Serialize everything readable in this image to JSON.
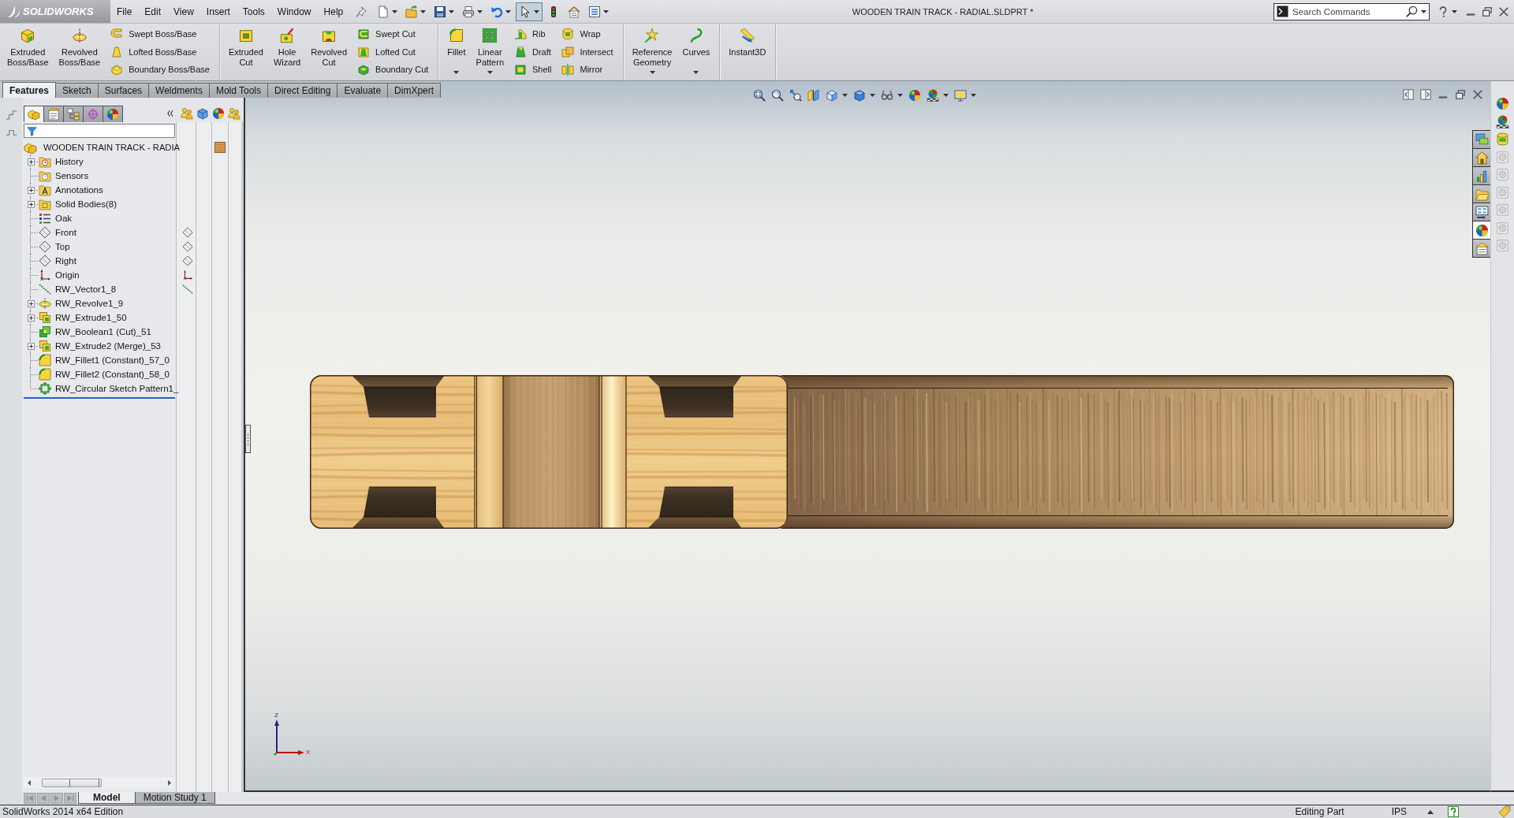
{
  "app": {
    "logo": "SOLIDWORKS"
  },
  "menu": [
    "File",
    "Edit",
    "View",
    "Insert",
    "Tools",
    "Window",
    "Help"
  ],
  "quick_access": [
    {
      "kind": "new",
      "dropdown": true,
      "pressed": false
    },
    {
      "kind": "open",
      "dropdown": true,
      "pressed": false
    },
    {
      "kind": "save",
      "dropdown": true,
      "pressed": false
    },
    {
      "kind": "print",
      "dropdown": true,
      "pressed": false
    },
    {
      "kind": "undo",
      "dropdown": true,
      "pressed": false
    },
    {
      "kind": "select",
      "dropdown": true,
      "pressed": true
    },
    {
      "kind": "rebuild",
      "dropdown": false,
      "pressed": false
    },
    {
      "kind": "file-properties",
      "dropdown": false,
      "pressed": false
    },
    {
      "kind": "options",
      "dropdown": true,
      "pressed": false
    }
  ],
  "window": {
    "title": "WOODEN TRAIN TRACK - RADIAL.SLDPRT *"
  },
  "search": {
    "placeholder": "Search Commands"
  },
  "command_manager": {
    "groups": [
      {
        "items": [
          {
            "label": "Extruded Boss/Base",
            "kind": "large",
            "dropdown": false
          },
          {
            "label": "Revolved Boss/Base",
            "kind": "large",
            "dropdown": false
          },
          {
            "label": "Swept Boss/Base",
            "kind": "small",
            "dropdown": false
          },
          {
            "label": "Lofted Boss/Base",
            "kind": "small",
            "dropdown": false
          },
          {
            "label": "Boundary Boss/Base",
            "kind": "small",
            "dropdown": false
          }
        ]
      },
      {
        "items": [
          {
            "label": "Extruded Cut",
            "kind": "large",
            "dropdown": false
          },
          {
            "label": "Hole Wizard",
            "kind": "large",
            "dropdown": false
          },
          {
            "label": "Revolved Cut",
            "kind": "large",
            "dropdown": false
          },
          {
            "label": "Swept Cut",
            "kind": "small",
            "dropdown": false
          },
          {
            "label": "Lofted Cut",
            "kind": "small",
            "dropdown": false
          },
          {
            "label": "Boundary Cut",
            "kind": "small",
            "dropdown": false
          }
        ]
      },
      {
        "items": [
          {
            "label": "Fillet",
            "kind": "large",
            "dropdown": true
          },
          {
            "label": "Linear Pattern",
            "kind": "large",
            "dropdown": true
          },
          {
            "label": "Rib",
            "kind": "small",
            "dropdown": false
          },
          {
            "label": "Draft",
            "kind": "small",
            "dropdown": false
          },
          {
            "label": "Shell",
            "kind": "small",
            "dropdown": false
          },
          {
            "label": "Wrap",
            "kind": "small",
            "dropdown": false
          },
          {
            "label": "Intersect",
            "kind": "small",
            "dropdown": false
          },
          {
            "label": "Mirror",
            "kind": "small",
            "dropdown": false
          }
        ]
      },
      {
        "items": [
          {
            "label": "Reference Geometry",
            "kind": "large",
            "dropdown": true
          },
          {
            "label": "Curves",
            "kind": "large",
            "dropdown": true
          }
        ]
      },
      {
        "items": [
          {
            "label": "Instant3D",
            "kind": "large",
            "dropdown": false
          }
        ]
      }
    ]
  },
  "tabs": [
    {
      "label": "Features",
      "selected": true
    },
    {
      "label": "Sketch",
      "selected": false
    },
    {
      "label": "Surfaces",
      "selected": false
    },
    {
      "label": "Weldments",
      "selected": false
    },
    {
      "label": "Mold Tools",
      "selected": false
    },
    {
      "label": "Direct Editing",
      "selected": false
    },
    {
      "label": "Evaluate",
      "selected": false
    },
    {
      "label": "DimXpert",
      "selected": false
    }
  ],
  "feature_manager": {
    "panel_tabs": [
      {
        "selected": true
      },
      {
        "selected": false
      },
      {
        "selected": false
      },
      {
        "selected": false
      },
      {
        "selected": false
      }
    ],
    "root": {
      "label": "WOODEN TRAIN TRACK - RADIA",
      "display": true
    },
    "items": [
      {
        "label": "History",
        "kind": "history",
        "expandable": true,
        "display": false
      },
      {
        "label": "Sensors",
        "kind": "sensors",
        "expandable": false,
        "display": false
      },
      {
        "label": "Annotations",
        "kind": "annotations",
        "expandable": true,
        "display": false
      },
      {
        "label": "Solid Bodies(8)",
        "kind": "bodies",
        "expandable": true,
        "display": false
      },
      {
        "label": "Oak",
        "kind": "material",
        "expandable": false,
        "display": false
      },
      {
        "label": "Front",
        "kind": "plane",
        "expandable": false,
        "display": true
      },
      {
        "label": "Top",
        "kind": "plane",
        "expandable": false,
        "display": true
      },
      {
        "label": "Right",
        "kind": "plane",
        "expandable": false,
        "display": true
      },
      {
        "label": "Origin",
        "kind": "origin",
        "expandable": false,
        "display": true
      },
      {
        "label": "RW_Vector1_8",
        "kind": "axis",
        "expandable": false,
        "display": true
      },
      {
        "label": "RW_Revolve1_9",
        "kind": "revolve",
        "expandable": true,
        "display": false
      },
      {
        "label": "RW_Extrude1_50",
        "kind": "extrude",
        "expandable": true,
        "display": false
      },
      {
        "label": "RW_Boolean1 (Cut)_51",
        "kind": "boolean",
        "expandable": false,
        "display": false
      },
      {
        "label": "RW_Extrude2 (Merge)_53",
        "kind": "extrude",
        "expandable": true,
        "display": false
      },
      {
        "label": "RW_Fillet1 (Constant)_57_0",
        "kind": "fillet",
        "expandable": false,
        "display": false
      },
      {
        "label": "RW_Fillet2 (Constant)_58_0",
        "kind": "fillet",
        "expandable": false,
        "display": false
      },
      {
        "label": "RW_Circular Sketch Pattern1_",
        "kind": "pattern",
        "expandable": false,
        "display": false
      }
    ]
  },
  "view_toolbar": [
    {
      "kind": "zoom-fit",
      "dropdown": false
    },
    {
      "kind": "zoom-area",
      "dropdown": false
    },
    {
      "kind": "previous-view",
      "dropdown": false
    },
    {
      "kind": "section-view",
      "dropdown": false
    },
    {
      "kind": "view-orientation",
      "dropdown": true
    },
    {
      "kind": "display-style",
      "dropdown": true
    },
    {
      "kind": "hide-show",
      "dropdown": true
    },
    {
      "kind": "edit-appearance",
      "dropdown": false
    },
    {
      "kind": "apply-scene",
      "dropdown": true
    },
    {
      "kind": "view-settings",
      "dropdown": true
    }
  ],
  "task_pane": [
    {
      "kind": "resources",
      "selected": false
    },
    {
      "kind": "design-library",
      "selected": false
    },
    {
      "kind": "file-explorer",
      "selected": false
    },
    {
      "kind": "folder",
      "selected": false
    },
    {
      "kind": "view-palette",
      "selected": false
    },
    {
      "kind": "appearances",
      "selected": true
    },
    {
      "kind": "custom-properties",
      "selected": false
    }
  ],
  "display_strip": [
    {
      "kind": "appearance",
      "disabled": false
    },
    {
      "kind": "scene",
      "disabled": false
    },
    {
      "kind": "database",
      "disabled": false
    },
    {
      "kind": "display",
      "disabled": true
    },
    {
      "kind": "display",
      "disabled": true
    },
    {
      "kind": "display",
      "disabled": true
    },
    {
      "kind": "display",
      "disabled": true
    },
    {
      "kind": "display",
      "disabled": true
    },
    {
      "kind": "display",
      "disabled": true
    }
  ],
  "triad": {
    "vertical": "Z",
    "horizontal": "X"
  },
  "bottom_tabs": [
    {
      "label": "Model",
      "selected": true
    },
    {
      "label": "Motion Study 1",
      "selected": false
    }
  ],
  "status_bar": {
    "product": "SolidWorks 2014 x64 Edition",
    "mode": "Editing Part",
    "units": "IPS"
  }
}
